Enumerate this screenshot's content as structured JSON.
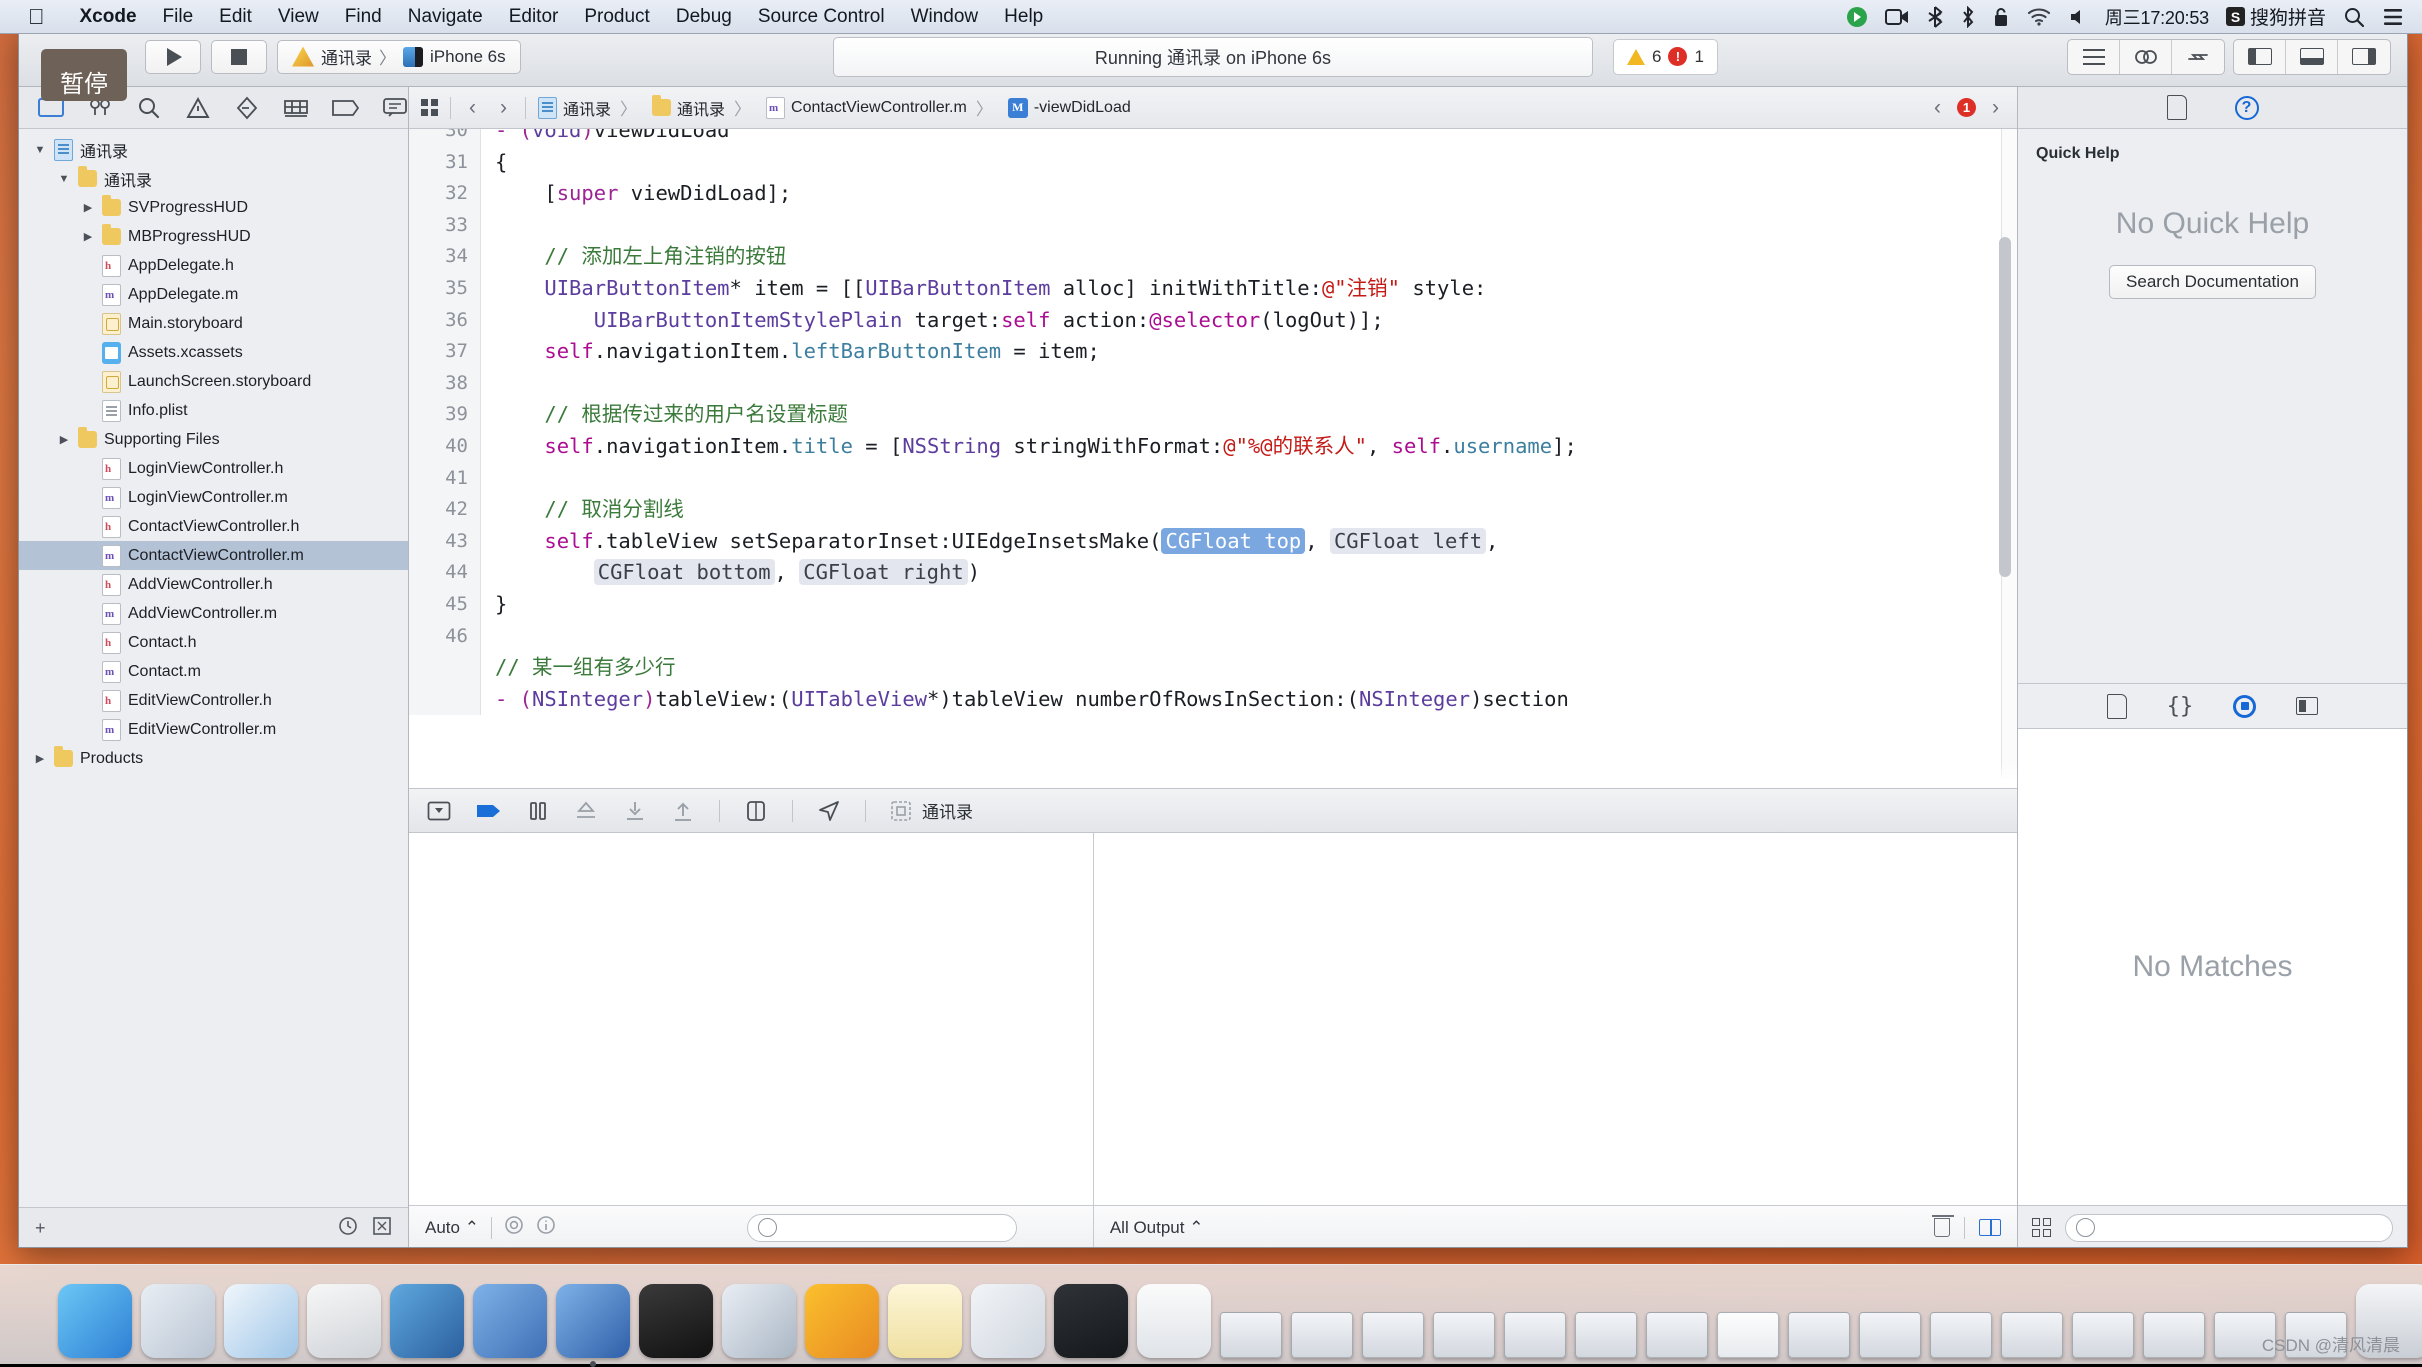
{
  "menubar": {
    "apple_icon": "apple-icon",
    "items": [
      "Xcode",
      "File",
      "Edit",
      "View",
      "Find",
      "Navigate",
      "Editor",
      "Product",
      "Debug",
      "Source Control",
      "Window",
      "Help"
    ],
    "status": {
      "icons": [
        "dropbox-icon",
        "screen-recording-icon",
        "bluetooth-tether-icon",
        "bluetooth-icon",
        "lock-icon",
        "wifi-icon",
        "volume-icon"
      ],
      "clock": "周三17:20:53",
      "input_method_badge": "S",
      "input_method": "搜狗拼音",
      "search_icon": "search-icon",
      "control_center_icon": "list-icon"
    }
  },
  "toolbar": {
    "tooltip": "暂停",
    "run_button": "run-button",
    "stop_button": "stop-button",
    "scheme_name": "通讯录",
    "scheme_separator": "〉",
    "destination": "iPhone 6s",
    "activity_status": "Running 通讯录 on iPhone 6s",
    "warning_count": "6",
    "error_count": "1",
    "error_glyph": "!",
    "right_icons": [
      "editor-standard-icon",
      "assistant-editor-icon",
      "version-editor-icon",
      "navigator-toggle-icon",
      "debug-area-toggle-icon",
      "utilities-toggle-icon"
    ]
  },
  "navigator": {
    "tabs": [
      "project-navigator-icon",
      "symbol-navigator-icon",
      "find-navigator-icon",
      "issue-navigator-icon",
      "test-navigator-icon",
      "debug-navigator-icon",
      "breakpoint-navigator-icon",
      "report-navigator-icon"
    ],
    "items": [
      {
        "label": "通讯录",
        "indent": 0,
        "twisty": "▼",
        "icon": "proj",
        "sel": false
      },
      {
        "label": "通讯录",
        "indent": 1,
        "twisty": "▼",
        "icon": "fold",
        "sel": false
      },
      {
        "label": "SVProgressHUD",
        "indent": 2,
        "twisty": "▶",
        "icon": "fold",
        "sel": false
      },
      {
        "label": "MBProgressHUD",
        "indent": 2,
        "twisty": "▶",
        "icon": "fold",
        "sel": false
      },
      {
        "label": "AppDelegate.h",
        "indent": 2,
        "twisty": "",
        "icon": "h",
        "sel": false
      },
      {
        "label": "AppDelegate.m",
        "indent": 2,
        "twisty": "",
        "icon": "m",
        "sel": false
      },
      {
        "label": "Main.storyboard",
        "indent": 2,
        "twisty": "",
        "icon": "sb",
        "sel": false
      },
      {
        "label": "Assets.xcassets",
        "indent": 2,
        "twisty": "",
        "icon": "xa",
        "sel": false
      },
      {
        "label": "LaunchScreen.storyboard",
        "indent": 2,
        "twisty": "",
        "icon": "sb",
        "sel": false
      },
      {
        "label": "Info.plist",
        "indent": 2,
        "twisty": "",
        "icon": "plist",
        "sel": false
      },
      {
        "label": "Supporting Files",
        "indent": 1,
        "twisty": "▶",
        "icon": "fold",
        "sel": false
      },
      {
        "label": "LoginViewController.h",
        "indent": 2,
        "twisty": "",
        "icon": "h",
        "sel": false
      },
      {
        "label": "LoginViewController.m",
        "indent": 2,
        "twisty": "",
        "icon": "m",
        "sel": false
      },
      {
        "label": "ContactViewController.h",
        "indent": 2,
        "twisty": "",
        "icon": "h",
        "sel": false
      },
      {
        "label": "ContactViewController.m",
        "indent": 2,
        "twisty": "",
        "icon": "m",
        "sel": true
      },
      {
        "label": "AddViewController.h",
        "indent": 2,
        "twisty": "",
        "icon": "h",
        "sel": false
      },
      {
        "label": "AddViewController.m",
        "indent": 2,
        "twisty": "",
        "icon": "m",
        "sel": false
      },
      {
        "label": "Contact.h",
        "indent": 2,
        "twisty": "",
        "icon": "h",
        "sel": false
      },
      {
        "label": "Contact.m",
        "indent": 2,
        "twisty": "",
        "icon": "m",
        "sel": false
      },
      {
        "label": "EditViewController.h",
        "indent": 2,
        "twisty": "",
        "icon": "h",
        "sel": false
      },
      {
        "label": "EditViewController.m",
        "indent": 2,
        "twisty": "",
        "icon": "m",
        "sel": false
      },
      {
        "label": "Products",
        "indent": 0,
        "twisty": "▶",
        "icon": "fold",
        "sel": false
      }
    ],
    "footer": {
      "add": "+",
      "filter_icon": "filter-icon",
      "clock_icon": "recent-icon",
      "source_icon": "source-control-icon"
    }
  },
  "jumpbar": {
    "related_icon": "related-files-icon",
    "back": "‹",
    "forward": "›",
    "crumbs": [
      "通讯录",
      "通讯录",
      "ContactViewController.m",
      "-viewDidLoad"
    ],
    "separator": "〉",
    "prev_issue": "‹",
    "next_issue": "›",
    "issue_count": "1"
  },
  "editor": {
    "lines": [
      {
        "n": "30",
        "html": "<span class='k'>- (</span><span class='ty'>void</span><span class='k'>)</span>viewDidLoad"
      },
      {
        "n": "31",
        "html": "{"
      },
      {
        "n": "32",
        "html": "    [<span class='k'>super</span> viewDidLoad];"
      },
      {
        "n": "33",
        "html": ""
      },
      {
        "n": "34",
        "html": "    <span class='cm'>// 添加左上角注销的按钮</span>"
      },
      {
        "n": "35",
        "html": "    <span class='ty'>UIBarButtonItem</span>* item = [[<span class='ty'>UIBarButtonItem</span> alloc] initWithTitle:<span class='st'>@\"注销\"</span> style:"
      },
      {
        "n": "",
        "html": "        <span class='ty'>UIBarButtonItemStylePlain</span> target:<span class='pr'>self</span> action:<span class='pr'>@selector</span>(logOut)];"
      },
      {
        "n": "36",
        "html": "    <span class='pr'>self</span>.navigationItem.<span class='pp'>leftBarButtonItem</span> = item;"
      },
      {
        "n": "37",
        "html": ""
      },
      {
        "n": "38",
        "html": "    <span class='cm'>// 根据传过来的用户名设置标题</span>"
      },
      {
        "n": "39",
        "html": "    <span class='pr'>self</span>.navigationItem.<span class='pp'>title</span> = [<span class='ty'>NSString</span> stringWithFormat:<span class='st'>@\"%@的联系人\"</span>, <span class='pr'>self</span>.<span class='pp'>username</span>];"
      },
      {
        "n": "40",
        "html": ""
      },
      {
        "n": "41",
        "html": "    <span class='cm'>// 取消分割线</span>"
      },
      {
        "n": "42",
        "html": "    <span class='pr'>self</span>.tableView setSeparatorInset:UIEdgeInsetsMake(<span class='ph sel'>CGFloat top</span>, <span class='ph'>CGFloat left</span>,"
      },
      {
        "n": "",
        "html": "        <span class='ph'>CGFloat bottom</span>, <span class='ph'>CGFloat right</span>)"
      },
      {
        "n": "43",
        "html": "}"
      },
      {
        "n": "44",
        "html": ""
      },
      {
        "n": "45",
        "html": "<span class='cm'>// 某一组有多少行</span>"
      },
      {
        "n": "46",
        "html": "<span class='k'>- (</span><span class='ty'>NSInteger</span><span class='k'>)</span>tableView:(<span class='ty'>UITableView</span>*)tableView numberOfRowsInSection:(<span class='ty'>NSInteger</span>)section"
      }
    ]
  },
  "debugbar": {
    "icons": [
      "hide-debug-area-icon",
      "continue-icon",
      "pause-icon",
      "step-over-icon",
      "step-into-icon",
      "step-out-icon",
      "view-hierarchy-icon",
      "location-simulate-icon",
      "process-icon"
    ],
    "process_label": "通讯录"
  },
  "debugarea": {
    "variables_scope": "Auto",
    "scope_chevron": "⌃",
    "variables_filter_placeholder": "",
    "console_scope": "All Output",
    "console_chevron": "⌃",
    "vars_icons": [
      "scope-icon",
      "info-icon"
    ],
    "console_icons": [
      "trash-icon",
      "split-view-icon"
    ]
  },
  "inspector": {
    "tabs": [
      "file-inspector-icon",
      "quick-help-icon"
    ],
    "quick_help_title": "Quick Help",
    "quick_help_empty": "No Quick Help",
    "search_doc_button": "Search Documentation",
    "library_tabs": [
      "file-template-library-icon",
      "code-snippet-library-icon",
      "object-library-icon",
      "media-library-icon"
    ],
    "library_empty": "No Matches",
    "footer_icons": [
      "library-grid-icon"
    ],
    "footer_filter_placeholder": ""
  },
  "dock": {
    "items": [
      {
        "name": "finder-icon",
        "color": "linear-gradient(135deg,#6cc7f5,#2d7fd4)"
      },
      {
        "name": "launchpad-icon",
        "color": "linear-gradient(135deg,#e9eef4,#b9c4d2)"
      },
      {
        "name": "safari-icon",
        "color": "linear-gradient(135deg,#f0f6fb,#9fc6e8)"
      },
      {
        "name": "mouse-app-icon",
        "color": "linear-gradient(160deg,#f7f7f7,#cfd3d8)"
      },
      {
        "name": "screenshot-app-icon",
        "color": "linear-gradient(135deg,#5fa9df,#2b5f9e)"
      },
      {
        "name": "xcode-beta-icon",
        "color": "linear-gradient(135deg,#7fb2e8,#3f6fb5)"
      },
      {
        "name": "xcode-icon",
        "color": "linear-gradient(135deg,#7fb2e8,#2f5fa8)"
      },
      {
        "name": "terminal-icon",
        "color": "linear-gradient(160deg,#3a3a3a,#111)"
      },
      {
        "name": "browser-icon",
        "color": "linear-gradient(135deg,#e9eef4,#aab6c4)"
      },
      {
        "name": "sketch-icon",
        "color": "linear-gradient(135deg,#fbc02d,#e88a22)"
      },
      {
        "name": "notes-icon",
        "color": "linear-gradient(#fdf6d8,#efe0a0)"
      },
      {
        "name": "help-icon",
        "color": "linear-gradient(135deg,#f2f4f7,#cfd6df)"
      },
      {
        "name": "simulator-icon",
        "color": "linear-gradient(160deg,#2f3338,#15181b)"
      },
      {
        "name": "pages-icon",
        "color": "linear-gradient(#fbfbfb,#dfe3e8)"
      }
    ],
    "running_indicator": "running-dot",
    "windows": 16,
    "trash_icon": "trash-icon"
  },
  "watermark": "CSDN @清风清晨"
}
